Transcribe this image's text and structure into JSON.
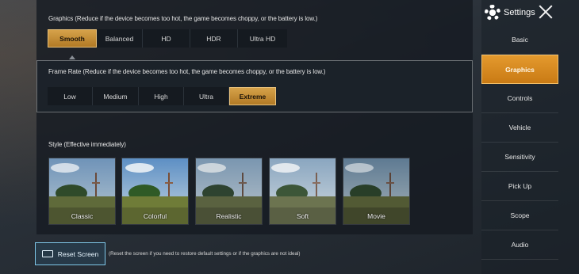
{
  "graphics": {
    "label": "Graphics (Reduce if the device becomes too hot, the game becomes choppy, or the battery is low.)",
    "options": [
      "Smooth",
      "Balanced",
      "HD",
      "HDR",
      "Ultra HD"
    ],
    "selected": "Smooth"
  },
  "frame_rate": {
    "label": "Frame Rate (Reduce if the device becomes too hot, the game becomes choppy, or the battery is low.)",
    "options": [
      "Low",
      "Medium",
      "High",
      "Ultra",
      "Extreme"
    ],
    "selected": "Extreme"
  },
  "style": {
    "label": "Style (Effective immediately)",
    "options": [
      "Classic",
      "Colorful",
      "Realistic",
      "Soft",
      "Movie"
    ]
  },
  "reset": {
    "button_label": "Reset Screen",
    "note": "(Reset the screen if you need to restore default settings or if the graphics are not ideal)"
  },
  "sidebar": {
    "title": "Settings",
    "items": [
      "Basic",
      "Graphics",
      "Controls",
      "Vehicle",
      "Sensitivity",
      "Pick Up",
      "Scope",
      "Audio"
    ],
    "selected": "Graphics"
  },
  "colors": {
    "accent_gold": "#c9902f",
    "accent_orange": "#d98a1f",
    "reset_border": "#7fc7e8"
  }
}
